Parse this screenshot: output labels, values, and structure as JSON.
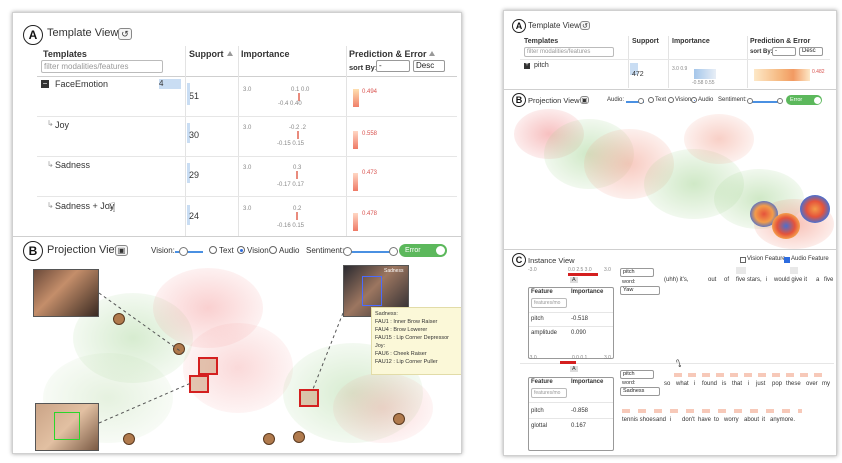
{
  "left": {
    "template_view": {
      "badge": "A",
      "title": "Template View",
      "col_templates": "Templates",
      "col_support": "Support",
      "col_importance": "Importance",
      "col_prediction": "Prediction & Error",
      "filter_placeholder": "filter modalities/features",
      "sort_by_label": "sort By:",
      "sort_value": "-",
      "order_value": "Desc",
      "rows": [
        {
          "name": "FaceEmotion",
          "count_badge": "4",
          "support": "51",
          "imp_left": "3.0",
          "imp_top": "0.1 0.0",
          "imp_bottom": "-0.4     0.40",
          "pred": "0.494"
        },
        {
          "name": "Joy",
          "support": "30",
          "imp_left": "3.0",
          "imp_top": "-0.2 .2",
          "imp_bottom": "-0.15    0.15",
          "pred": "0.558"
        },
        {
          "name": "Sadness",
          "support": "29",
          "imp_left": "3.0",
          "imp_top": "0.3",
          "imp_bottom": "-0.17   0.17",
          "pred": "0.473"
        },
        {
          "name": "Sadness + Joy",
          "support": "24",
          "imp_left": "3.0",
          "imp_top": "0.2",
          "imp_bottom": "-0.16    0.15",
          "pred": "0.478"
        }
      ]
    },
    "projection_view": {
      "badge": "B",
      "title": "Projection View",
      "vision_label": "Vision:",
      "radio_text": "Text",
      "radio_vision": "Vision",
      "radio_audio": "Audio",
      "sentiment_label": "Sentiment:",
      "error_toggle": "Error",
      "face_label": "Sadness",
      "tooltip_lines": [
        "Sadness:",
        "FAU1 : Inner Brow Raiser",
        "FAU4 : Brow Lowerer",
        "FAU15 : Lip Corner Depressor",
        "Joy:",
        "FAU6 : Cheek Raiser",
        "FAU12 : Lip Corner Puller"
      ]
    }
  },
  "right": {
    "template_view": {
      "badge": "A",
      "title": "Template View",
      "col_templates": "Templates",
      "col_support": "Support",
      "col_importance": "Importance",
      "col_prediction": "Prediction & Error",
      "filter_placeholder": "filter modalities/features",
      "sort_by_label": "sort By:",
      "sort_value": "-",
      "order_value": "Desc",
      "row_name": "pitch",
      "row_support": "472",
      "imp_top": "3.0                0.9",
      "imp_bottom": "-0.58      0.55",
      "pred_value": "0.482"
    },
    "projection_view": {
      "badge": "B",
      "title": "Projection View",
      "audio_label": "Audio:",
      "radio_text": "Text",
      "radio_vision": "Vision",
      "radio_audio": "Audio",
      "sentiment_label": "Sentiment:",
      "error_toggle": "Error"
    },
    "instance_view": {
      "badge": "C",
      "title": "Instance View",
      "vision_feature": "Vision Feature",
      "audio_feature": "Audio Feature",
      "block1": {
        "scale_left": "-3.0",
        "scale_ticks": "0.0       2.5 3.0",
        "scale_right": "3.0",
        "marker": "A",
        "col_feature": "Feature",
        "col_importance": "Importance",
        "filter_placeholder": "features/mo",
        "features": [
          {
            "name": "pitch",
            "value": "-0.518"
          },
          {
            "name": "amplitude",
            "value": "0.090"
          }
        ],
        "select_feature": "pitch",
        "word_label": "word:",
        "select_word": "Yaw",
        "sentence": [
          "(uhh) it's,",
          "out",
          "of",
          "five stars,",
          "i",
          "would give it",
          "a",
          "five"
        ]
      },
      "block2": {
        "scale_left": "-3.0",
        "scale_ticks": "0.0  0.1",
        "scale_right": "3.0",
        "marker": "A",
        "col_feature": "Feature",
        "col_importance": "Importance",
        "filter_placeholder": "features/mo",
        "features": [
          {
            "name": "pitch",
            "value": "-0.858"
          },
          {
            "name": "glottal",
            "value": "0.167"
          }
        ],
        "select_feature": "pitch",
        "word_label": "word:",
        "select_word": "Sadness",
        "sentence1": [
          "so",
          "what",
          "i",
          "found",
          "is",
          "that",
          "i",
          "just",
          "pop",
          "these",
          "over",
          "my"
        ],
        "sentence2": [
          "tennis shoes",
          "and",
          "i",
          "don't",
          "have",
          "to",
          "worry",
          "about",
          "it",
          "anymore."
        ]
      }
    }
  }
}
